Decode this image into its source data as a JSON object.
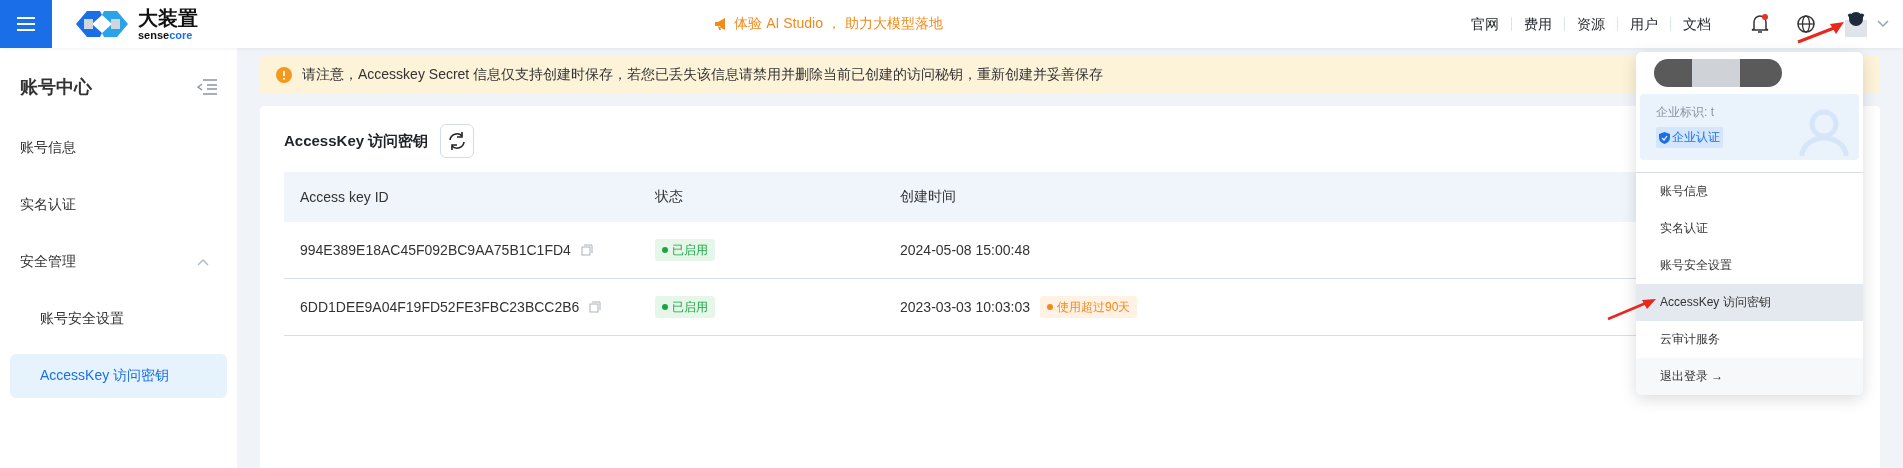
{
  "header": {
    "logo": {
      "name": "大装置",
      "subtitle_parts": [
        "sense",
        "core"
      ]
    },
    "promo": "体验 AI Studio ， 助力大模型落地",
    "nav": [
      "官网",
      "费用",
      "资源",
      "用户",
      "文档"
    ],
    "notification": {
      "unread": true
    }
  },
  "sidebar": {
    "title": "账号中心",
    "items": [
      {
        "label": "账号信息",
        "selected": false
      },
      {
        "label": "实名认证",
        "selected": false
      },
      {
        "label": "安全管理",
        "selected": false,
        "expanded": true,
        "children": [
          {
            "label": "账号安全设置",
            "selected": false
          },
          {
            "label": "AccessKey 访问密钥",
            "selected": true
          }
        ]
      }
    ]
  },
  "notice": "请注意，Accesskey Secret 信息仅支持创建时保存，若您已丢失该信息请禁用并删除当前已创建的访问秘钥，重新创建并妥善保存",
  "card": {
    "title": "AccessKey 访问密钥",
    "table": {
      "columns": [
        "Access key ID",
        "状态",
        "创建时间"
      ],
      "rows": [
        {
          "id": "994E389E18AC45F092BC9AA75B1C1FD4",
          "status": "已启用",
          "created": "2024-05-08 15:00:48"
        },
        {
          "id": "6DD1DEE9A04F19FD52FE3FBC23BCC2B6",
          "status": "已启用",
          "created": "2023-03-03 10:03:03",
          "warning": "使用超过90天"
        }
      ]
    }
  },
  "user_menu": {
    "org_label": "企业标识: t",
    "verified": "企业认证",
    "items": [
      {
        "label": "账号信息",
        "selected": false
      },
      {
        "label": "实名认证",
        "selected": false
      },
      {
        "label": "账号安全设置",
        "selected": false
      },
      {
        "label": "AccessKey 访问密钥",
        "selected": true
      },
      {
        "label": "云审计服务",
        "selected": false
      },
      {
        "label": "退出登录 →",
        "selected": false,
        "kind": "logout"
      }
    ]
  }
}
